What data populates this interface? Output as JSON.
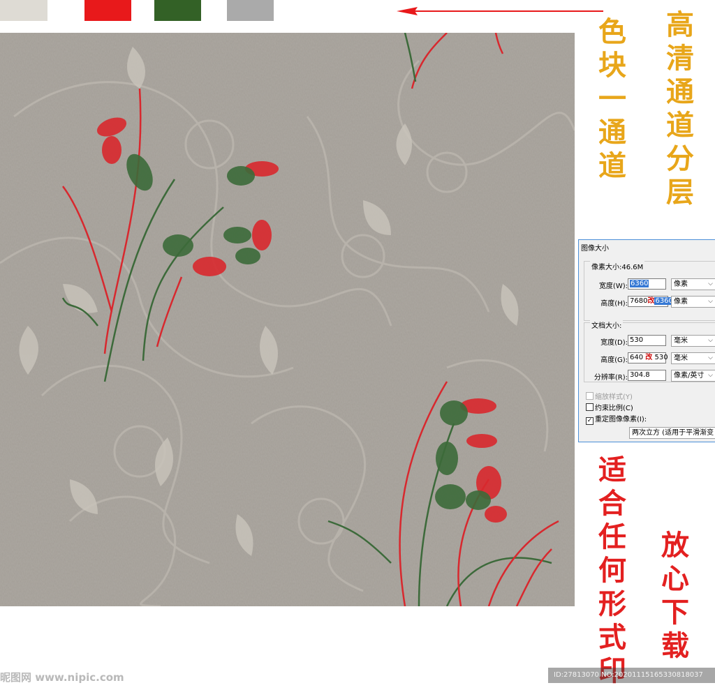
{
  "swatches": [
    {
      "name": "swatch-beige",
      "color": "#dedbd4"
    },
    {
      "name": "swatch-red",
      "color": "#e8191b"
    },
    {
      "name": "swatch-green",
      "color": "#336126"
    },
    {
      "name": "swatch-gray",
      "color": "#aaaaaa"
    }
  ],
  "arrow_color": "#e8191b",
  "pattern": {
    "background": "#a39e97",
    "flower_red": "#d8282e",
    "leaf_green": "#3c6a3a"
  },
  "side_text": {
    "one_swatch_one_channel": "一\n色\n块\n一\n通\n道",
    "hd_channel_layers": "高\n清\n通\n道\n分\n层",
    "suitable_for_any_print": "适\n合\n任\n何\n形\n式\n印",
    "download_safely": "放\n心\n下\n载"
  },
  "dialog": {
    "title": "图像大小",
    "pixel_size_label": "像素大小:46.6M",
    "width_label": "宽度(W):",
    "width_value": "6360",
    "width_unit": "像素",
    "height_label": "高度(H):",
    "height_prefix": "7680",
    "height_mark": "改",
    "height_value": "6360",
    "height_unit": "像素",
    "doc_size_label": "文档大小:",
    "doc_width_label": "宽度(D):",
    "doc_width_value": "530",
    "doc_width_unit": "毫米",
    "doc_height_label": "高度(G):",
    "doc_height_prefix": "640",
    "doc_height_mark": "改",
    "doc_height_value": "530",
    "doc_height_unit": "毫米",
    "resolution_label": "分辨率(R):",
    "resolution_value": "304.8",
    "resolution_unit": "像素/英寸",
    "scale_styles": "缩放样式(Y)",
    "constrain": "约束比例(C)",
    "resample": "重定图像像素(I):",
    "resample_method": "两次立方 (适用于平滑渐变"
  },
  "watermark": "昵图网 www.nipic.com",
  "id_bar": "ID:27813070 NO:20201115165330818037"
}
